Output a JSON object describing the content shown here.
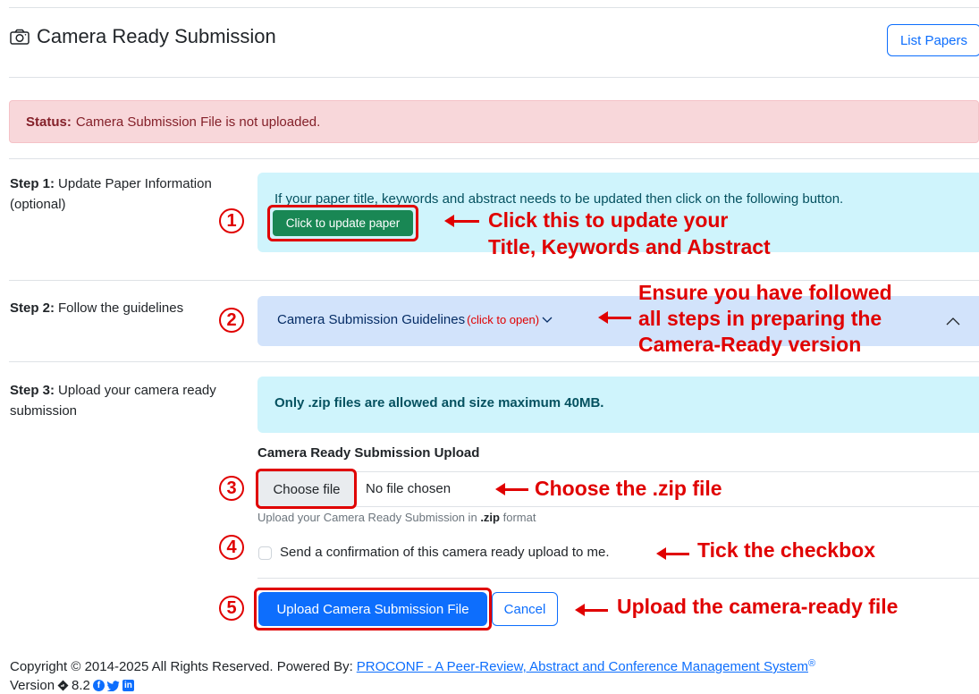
{
  "header": {
    "title": "Camera Ready Submission",
    "list_papers_label": "List Papers"
  },
  "status": {
    "label": "Status:",
    "message": "Camera Submission File is not uploaded."
  },
  "step1": {
    "label": "Step 1:",
    "title": "Update Paper Information (optional)",
    "info": "If your paper title, keywords and abstract needs to be updated then click on the following button.",
    "button": "Click to update paper"
  },
  "step2": {
    "label": "Step 2:",
    "title": "Follow the guidelines",
    "accordion_title": "Camera Submission Guidelines",
    "accordion_hint": "(click to open)"
  },
  "step3": {
    "label": "Step 3:",
    "title": "Upload your camera ready submission",
    "info": "Only .zip files are allowed and size maximum 40MB.",
    "upload_label": "Camera Ready Submission Upload",
    "choose_file": "Choose file",
    "no_file": "No file chosen",
    "help_prefix": "Upload your Camera Ready Submission in",
    "help_format": ".zip",
    "help_suffix": "format",
    "checkbox_label": "Send a confirmation of this camera ready upload to me.",
    "upload_button": "Upload Camera Submission File",
    "cancel_button": "Cancel"
  },
  "annotations": {
    "n1": "1",
    "n2": "2",
    "n3": "3",
    "n4": "4",
    "n5": "5",
    "a1_line1": "Click this to update your",
    "a1_line2": "Title, Keywords and Abstract",
    "a2_line1": "Ensure you have followed",
    "a2_line2": "all steps in preparing the",
    "a2_line3": "Camera-Ready version",
    "a3": "Choose the .zip file",
    "a4": "Tick the checkbox",
    "a5": "Upload the camera-ready file"
  },
  "footer": {
    "copyright": "Copyright © 2014-2025 All Rights Reserved. Powered By:",
    "link": "PROCONF - A Peer-Review, Abstract and Conference Management System",
    "registered": "®",
    "version_label": "Version",
    "version": "8.2"
  },
  "colors": {
    "annotation_red": "#e00000",
    "primary": "#0d6efd",
    "success": "#198754",
    "danger_bg": "#f8d7da"
  },
  "icons": [
    "camera-icon",
    "chevron-down-icon",
    "chevron-up-icon",
    "diamond-icon",
    "facebook-icon",
    "twitter-icon",
    "linkedin-icon"
  ]
}
